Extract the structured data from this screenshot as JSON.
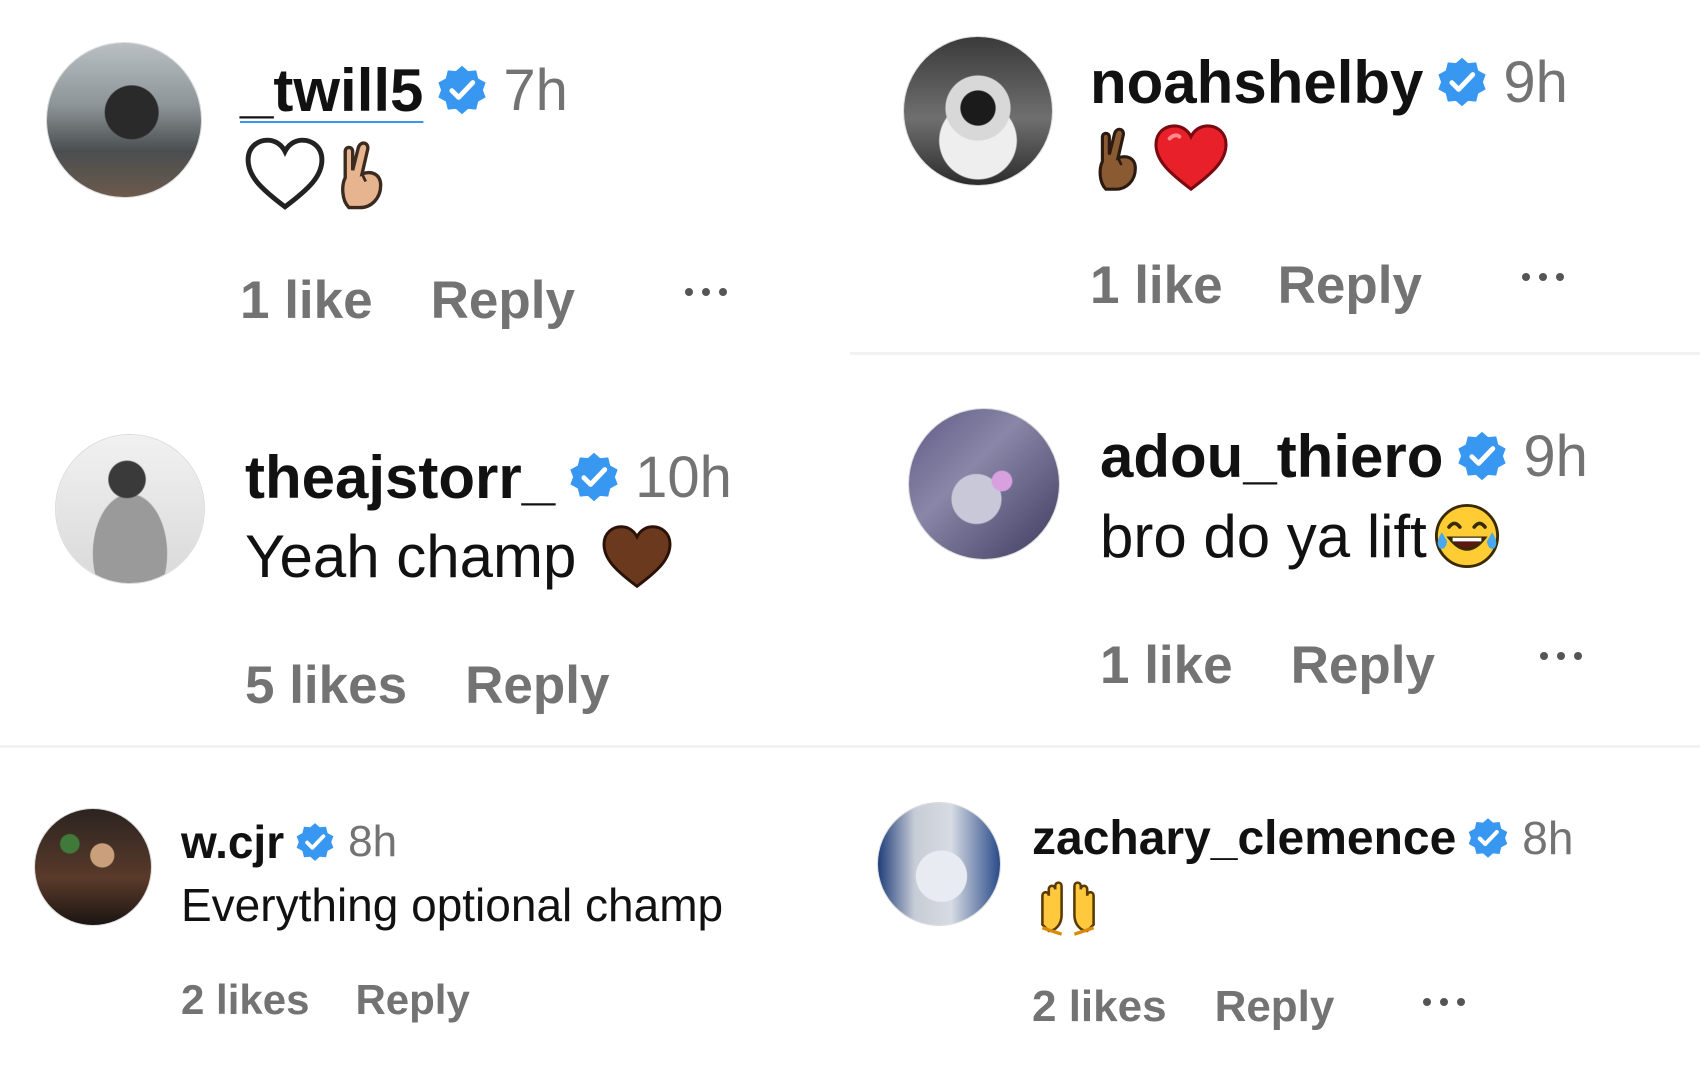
{
  "comments": [
    {
      "username": "_twill5",
      "time": "7h",
      "text": "",
      "emojis": [
        "white-heart",
        "crossed-fingers"
      ],
      "likes": "1 like",
      "reply": "Reply",
      "verified": true
    },
    {
      "username": "noahshelby",
      "time": "9h",
      "text": "",
      "emojis": [
        "crossed-fingers",
        "red-heart"
      ],
      "likes": "1 like",
      "reply": "Reply",
      "verified": true
    },
    {
      "username": "theajstorr_",
      "time": "10h",
      "text": "Yeah champ",
      "emojis": [
        "brown-heart"
      ],
      "likes": "5 likes",
      "reply": "Reply",
      "verified": true
    },
    {
      "username": "adou_thiero",
      "time": "9h",
      "text": "bro do ya lift",
      "emojis": [
        "tears-of-joy"
      ],
      "likes": "1 like",
      "reply": "Reply",
      "verified": true
    },
    {
      "username": "w.cjr",
      "time": "8h",
      "text": "Everything optional champ",
      "emojis": [],
      "likes": "2 likes",
      "reply": "Reply",
      "verified": true
    },
    {
      "username": "zachary_clemence",
      "time": "8h",
      "text": "",
      "emojis": [
        "raising-hands"
      ],
      "likes": "2 likes",
      "reply": "Reply",
      "verified": true
    }
  ],
  "colors": {
    "verified_badge": "#3897f0",
    "meta_text": "#737373",
    "username_text": "#111111"
  }
}
